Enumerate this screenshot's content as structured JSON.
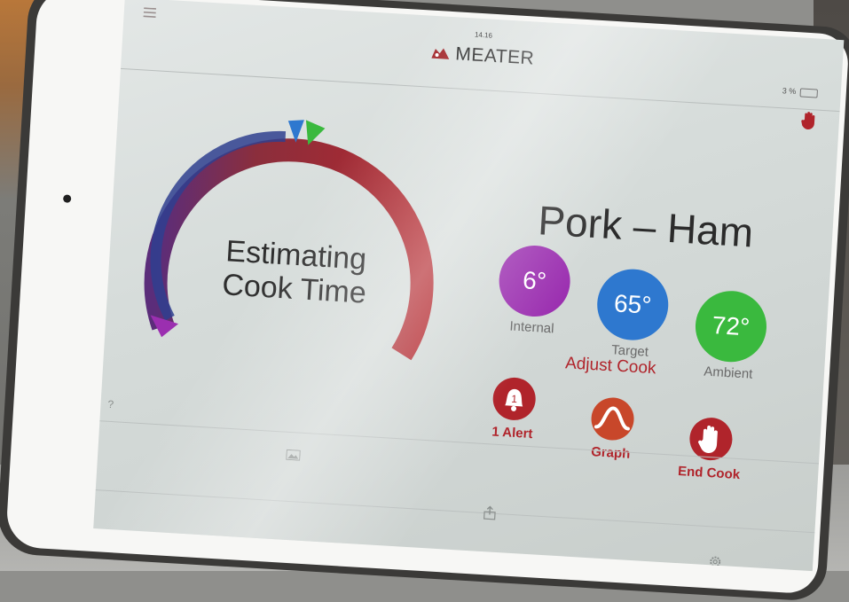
{
  "status_bar": {
    "time": "14.16",
    "battery": "3 %"
  },
  "app": {
    "logo_text": "MEATER"
  },
  "cook": {
    "food": "Pork – Ham",
    "status_line1": "Estimating",
    "status_line2": "Cook Time"
  },
  "temps": [
    {
      "value": "6°",
      "label": "Internal",
      "color": "#9b2fb0"
    },
    {
      "value": "65°",
      "label": "Target",
      "color": "#2e78cf"
    },
    {
      "value": "72°",
      "label": "Ambient",
      "color": "#3ab93e"
    }
  ],
  "adjust_cook_label": "Adjust Cook",
  "actions": [
    {
      "label": "1 Alert",
      "badge": "1",
      "icon": "bell-icon"
    },
    {
      "label": "Graph",
      "icon": "graph-icon"
    },
    {
      "label": "End Cook",
      "icon": "hand-stop-icon"
    }
  ],
  "colors": {
    "accent": "#b0242b",
    "internal": "#9b2fb0",
    "target": "#2e78cf",
    "ambient": "#3ab93e"
  },
  "icons": {
    "menu": "menu-icon",
    "end_cook_top": "hand-stop-icon",
    "help": "help-icon",
    "gallery": "image-icon",
    "share": "share-icon",
    "settings": "gear-icon"
  }
}
